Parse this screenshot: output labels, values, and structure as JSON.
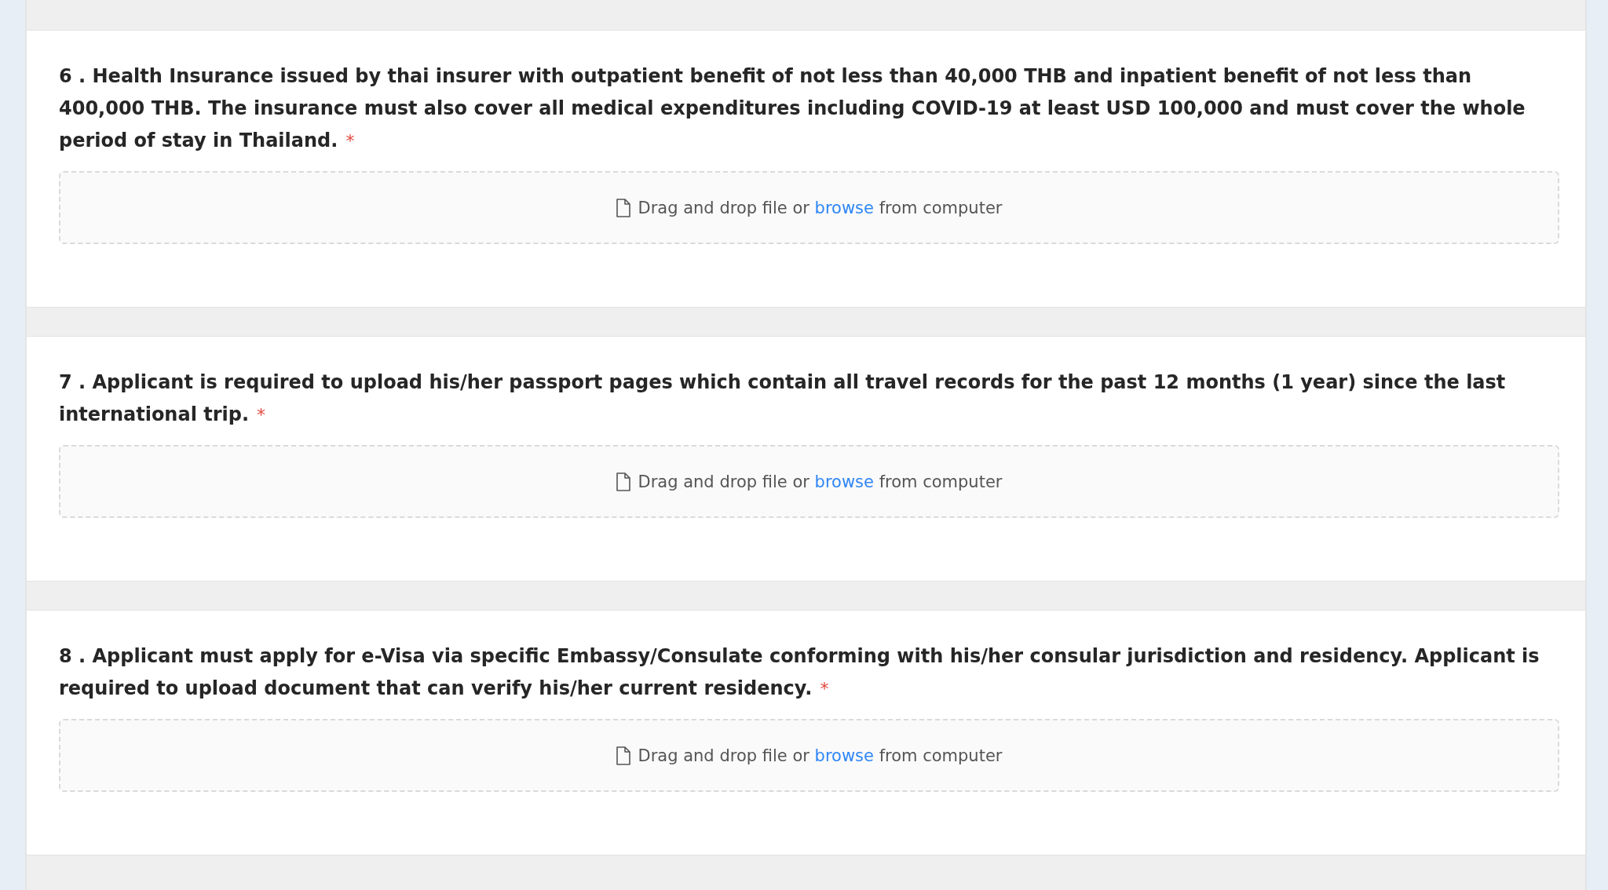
{
  "questions": [
    {
      "text": "6 . Health Insurance issued by thai insurer with outpatient benefit of not less than 40,000 THB and inpatient benefit of not less than 400,000 THB. The insurance must also cover all medical expenditures including COVID-19 at least USD 100,000 and must cover the whole period of stay in Thailand.",
      "required": true,
      "required_mark": "*",
      "upload": {
        "before": "Drag and drop file or",
        "link": "browse",
        "after": "from computer"
      }
    },
    {
      "text": "7 . Applicant is required to upload his/her passport pages which contain all travel records for the past 12 months (1 year) since the last international trip.",
      "required": true,
      "required_mark": "*",
      "upload": {
        "before": "Drag and drop file or",
        "link": "browse",
        "after": "from computer"
      }
    },
    {
      "text": "8 . Applicant must apply for e-Visa via specific Embassy/Consulate conforming with his/her consular jurisdiction and residency. Applicant is required to upload document that can verify his/her current residency.",
      "required": true,
      "required_mark": "*",
      "upload": {
        "before": "Drag and drop file or",
        "link": "browse",
        "after": "from computer"
      }
    }
  ]
}
